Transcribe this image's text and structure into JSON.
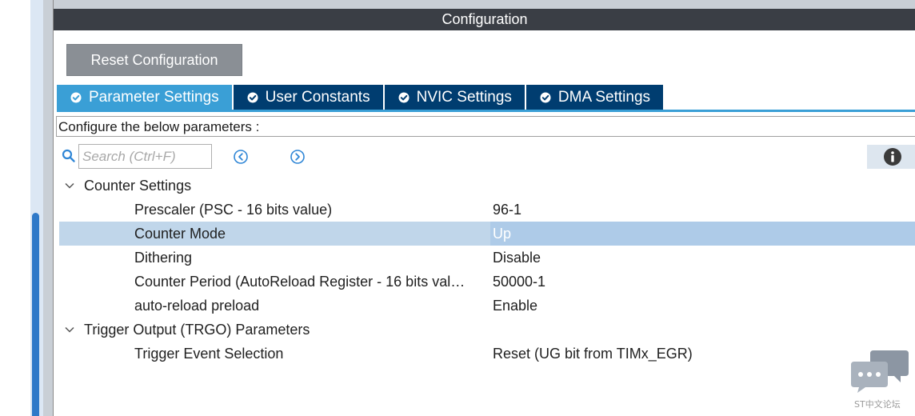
{
  "window": {
    "title": "Configuration"
  },
  "toolbar": {
    "reset_label": "Reset Configuration"
  },
  "tabs": [
    {
      "label": "Parameter Settings",
      "active": true
    },
    {
      "label": "User Constants",
      "active": false
    },
    {
      "label": "NVIC Settings",
      "active": false
    },
    {
      "label": "DMA Settings",
      "active": false
    }
  ],
  "description": "Configure the below parameters :",
  "search": {
    "placeholder": "Search (Ctrl+F)",
    "value": ""
  },
  "icons": {
    "search": "search-icon",
    "prev": "chevron-left-circle-icon",
    "next": "chevron-right-circle-icon",
    "info": "info-icon",
    "tab_check": "check-circle-icon",
    "group_expand": "chevron-down-icon"
  },
  "groups": [
    {
      "label": "Counter Settings",
      "params": [
        {
          "name": "Prescaler (PSC - 16 bits value)",
          "value": "96-1",
          "selected": false
        },
        {
          "name": "Counter Mode",
          "value": "Up",
          "selected": true
        },
        {
          "name": "Dithering",
          "value": "Disable",
          "selected": false
        },
        {
          "name": "Counter Period (AutoReload Register - 16 bits val…",
          "value": "50000-1",
          "selected": false
        },
        {
          "name": "auto-reload preload",
          "value": "Enable",
          "selected": false
        }
      ]
    },
    {
      "label": "Trigger Output (TRGO) Parameters",
      "params": [
        {
          "name": "Trigger Event Selection",
          "value": "Reset (UG bit from TIMx_EGR)",
          "selected": false
        }
      ]
    }
  ],
  "watermark": {
    "text": "ST中文论坛"
  },
  "colors": {
    "title_bar": "#3a3e45",
    "tab_active": "#3a9fd6",
    "tab_inactive": "#003d70",
    "selected_row": "#c0d6ea",
    "reset_button": "#8a8f95"
  }
}
